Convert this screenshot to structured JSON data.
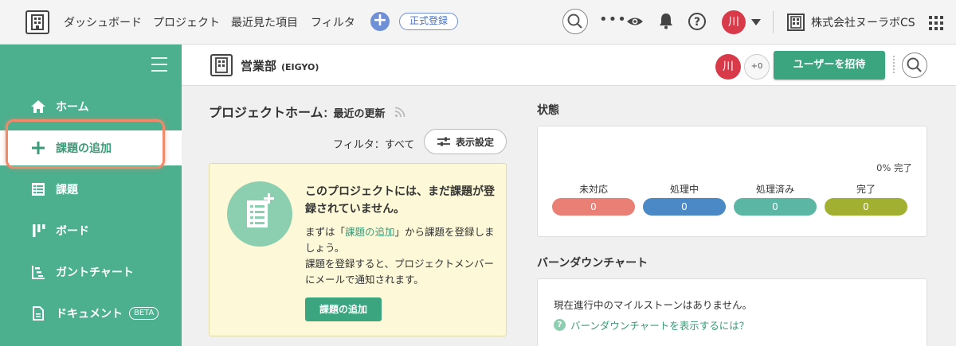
{
  "topbar": {
    "nav": [
      "ダッシュボード",
      "プロジェクト",
      "最近見た項目",
      "フィルタ"
    ],
    "register_label": "正式登録",
    "user_initial": "川",
    "company": "株式会社ヌーラボCS"
  },
  "sidebar": {
    "items": [
      {
        "label": "ホーム",
        "icon": "home-icon"
      },
      {
        "label": "課題の追加",
        "icon": "plus-icon"
      },
      {
        "label": "課題",
        "icon": "list-icon"
      },
      {
        "label": "ボード",
        "icon": "board-icon"
      },
      {
        "label": "ガントチャート",
        "icon": "gantt-icon"
      },
      {
        "label": "ドキュメント",
        "icon": "document-icon",
        "badge": "BETA"
      }
    ]
  },
  "project": {
    "name": "営業部",
    "key": "(EIGYO)",
    "member_initial": "川",
    "more_members": "+0",
    "invite_label": "ユーザーを招待"
  },
  "home": {
    "title": "プロジェクトホーム",
    "separator": "：",
    "subtitle": "最近の更新",
    "filter_text": "フィルタ：すべて",
    "display_settings": "表示設定"
  },
  "empty": {
    "title": "このプロジェクトには、まだ課題が登録されていません。",
    "desc_pre": "まずは「",
    "desc_link": "課題の追加",
    "desc_post": "」から課題を登録しましょう。",
    "desc2": "課題を登録すると、プロジェクトメンバーにメールで通知されます。",
    "button": "課題の追加"
  },
  "status": {
    "title": "状態",
    "percent_label": "0% 完了",
    "items": [
      {
        "label": "未対応",
        "value": "0",
        "color": "#ea7f76"
      },
      {
        "label": "処理中",
        "value": "0",
        "color": "#4b88c6"
      },
      {
        "label": "処理済み",
        "value": "0",
        "color": "#5bb7a4"
      },
      {
        "label": "完了",
        "value": "0",
        "color": "#a1b031"
      }
    ]
  },
  "burndown": {
    "title": "バーンダウンチャート",
    "message": "現在進行中のマイルストーンはありません。",
    "help": "バーンダウンチャートを表示するには？"
  },
  "colors": {
    "accent": "#4caf8e",
    "button": "#3aa57f",
    "highlight": "#f08a6b"
  }
}
